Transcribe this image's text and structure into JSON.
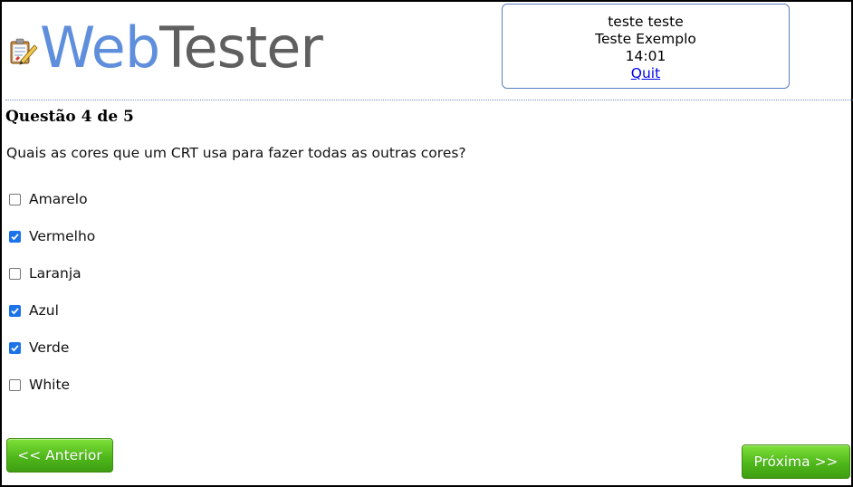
{
  "logo": {
    "web": "Web",
    "tester": "Tester",
    "icon": "notepad-edit-icon"
  },
  "info": {
    "user": "teste teste",
    "test_name": "Teste Exemplo",
    "time": "14:01",
    "quit_label": "Quit"
  },
  "question": {
    "title": "Questão 4 de 5",
    "text": "Quais as cores que um CRT usa para fazer todas as outras cores?",
    "options": [
      {
        "label": "Amarelo",
        "checked": false
      },
      {
        "label": "Vermelho",
        "checked": true
      },
      {
        "label": "Laranja",
        "checked": false
      },
      {
        "label": "Azul",
        "checked": true
      },
      {
        "label": "Verde",
        "checked": true
      },
      {
        "label": "White",
        "checked": false
      }
    ]
  },
  "nav": {
    "prev_label": "<< Anterior",
    "next_label": "Próxima >>"
  },
  "colors": {
    "logo_web": "#5f8fdc",
    "logo_tester": "#5f5f5f",
    "button_green": "#4fb81a",
    "checkbox_checked": "#1a73e8"
  }
}
